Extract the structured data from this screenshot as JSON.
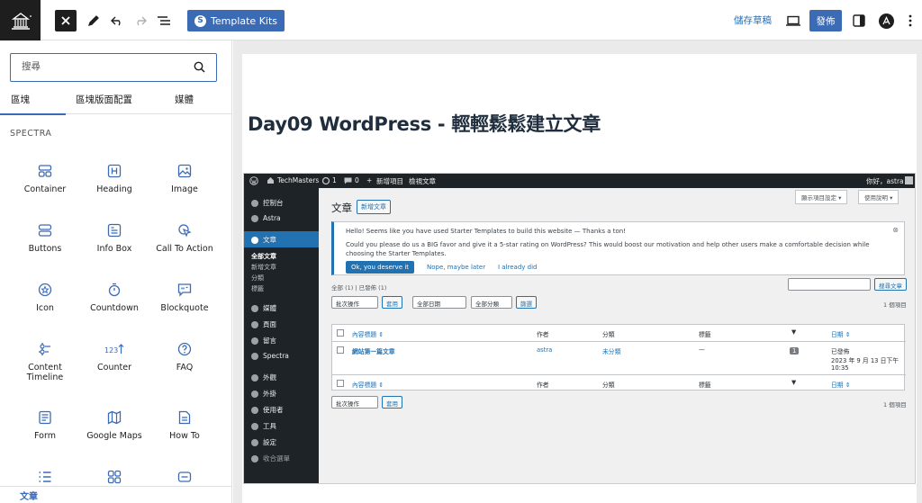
{
  "toolbar": {
    "template_kits_label": "Template Kits",
    "save_draft_label": "儲存草稿",
    "publish_label": "發佈"
  },
  "sidebar": {
    "search_placeholder": "搜尋",
    "tabs": [
      "區塊",
      "區塊版面配置",
      "媒體"
    ],
    "category_title": "SPECTRA",
    "blocks": [
      {
        "label": "Container",
        "icon": "container-icon"
      },
      {
        "label": "Heading",
        "icon": "heading-icon"
      },
      {
        "label": "Image",
        "icon": "image-icon"
      },
      {
        "label": "Buttons",
        "icon": "buttons-icon"
      },
      {
        "label": "Info Box",
        "icon": "info-box-icon"
      },
      {
        "label": "Call To Action",
        "icon": "call-to-action-icon"
      },
      {
        "label": "Icon",
        "icon": "icon-block-icon"
      },
      {
        "label": "Countdown",
        "icon": "countdown-icon"
      },
      {
        "label": "Blockquote",
        "icon": "blockquote-icon"
      },
      {
        "label": "Content Timeline",
        "icon": "content-timeline-icon"
      },
      {
        "label": "Counter",
        "icon": "counter-icon"
      },
      {
        "label": "FAQ",
        "icon": "faq-icon"
      },
      {
        "label": "Form",
        "icon": "form-icon"
      },
      {
        "label": "Google Maps",
        "icon": "google-maps-icon"
      },
      {
        "label": "How To",
        "icon": "how-to-icon"
      }
    ],
    "counter_glyph": "123",
    "breadcrumb": "文章"
  },
  "canvas": {
    "post_title": "Day09 WordPress - 輕輕鬆鬆建立文章"
  },
  "screenshot": {
    "admin_bar": {
      "site": "TechMasters",
      "updates": "1",
      "comments": "0",
      "new": "新增項目",
      "view": "檢視文章",
      "greeting": "你好，astra"
    },
    "menu": {
      "dashboard": "控制台",
      "astra": "Astra",
      "posts": "文章",
      "all_posts": "全部文章",
      "add_new": "新增文章",
      "categories": "分類",
      "tags": "標籤",
      "media": "媒體",
      "pages": "頁面",
      "comments": "留言",
      "spectra": "Spectra",
      "appearance": "外觀",
      "plugins": "外掛",
      "users": "使用者",
      "tools": "工具",
      "settings": "設定",
      "collapse": "收合選單"
    },
    "heading": "文章",
    "new_post_btn": "新增文章",
    "screen_options": "顯示項目設定 ▾",
    "help": "使用說明 ▾",
    "notice": {
      "line1": "Hello! Seems like you have used Starter Templates to build this website — Thanks a ton!",
      "line2": "Could you please do us a BIG favor and give it a 5-star rating on WordPress? This would boost our motivation and help other users make a comfortable decision while choosing the Starter Templates.",
      "ok": "Ok, you deserve it",
      "nope": "Nope, maybe later",
      "did": "I already did"
    },
    "views": "全部 (1) | 已發佈 (1)",
    "search_btn": "搜尋文章",
    "bulk_action": "批次操作",
    "apply": "套用",
    "all_dates": "全部日期",
    "all_categories": "全部分類",
    "filter": "篩選",
    "item_count": "1 個項目",
    "columns": {
      "title": "內容標題 ⇕",
      "author": "作者",
      "categories": "分類",
      "tags": "標籤",
      "date": "日期 ⇕"
    },
    "row": {
      "title": "網站第一篇文章",
      "author": "astra",
      "category": "未分類",
      "tags": "—",
      "comments": "1",
      "status": "已發佈",
      "date": "2023 年 9 月 13 日下午",
      "time": "10:35"
    }
  }
}
